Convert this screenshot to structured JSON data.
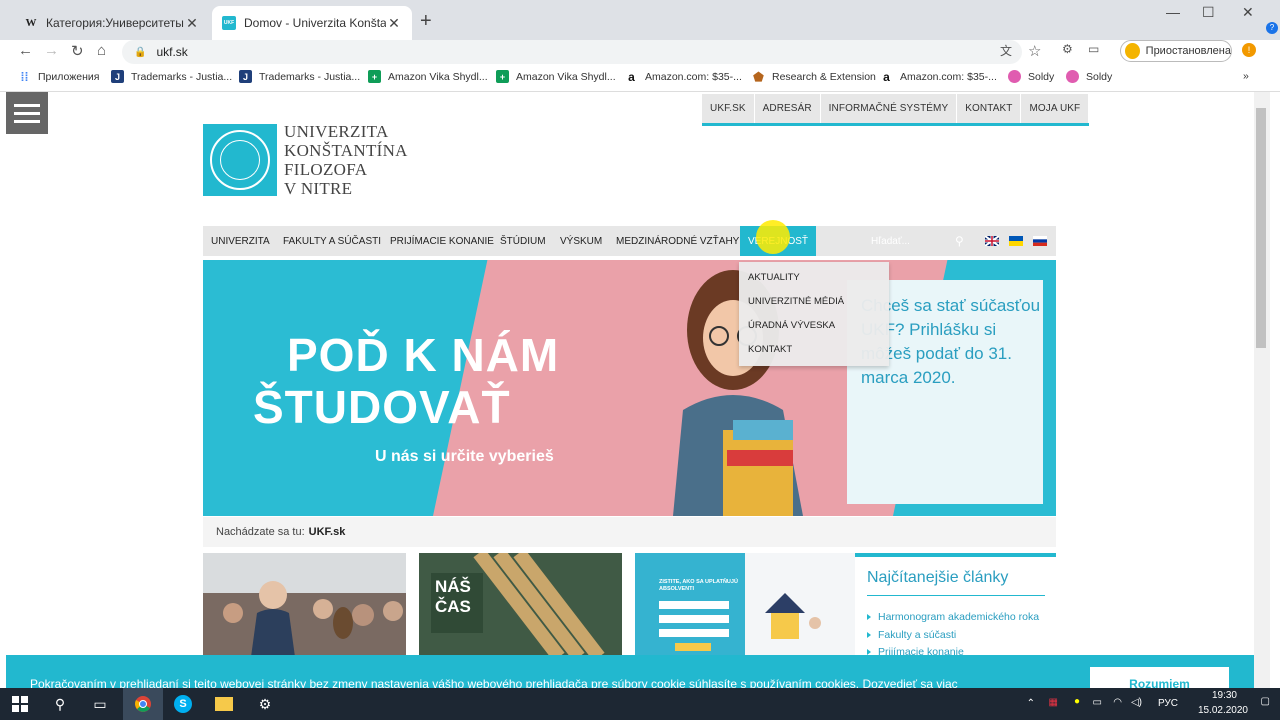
{
  "browser": {
    "tabs": [
      {
        "title": "Категория:Университеты Слова",
        "favicon": "W",
        "active": false
      },
      {
        "title": "Domov - Univerzita Konštantína F",
        "favicon": "UKF",
        "active": true
      }
    ],
    "new_tab_glyph": "+",
    "url": "ukf.sk",
    "profile_label": "Приостановлена",
    "bookmarks": [
      {
        "label": "Приложения",
        "icon": "apps-grid-icon",
        "color": "#4285f4"
      },
      {
        "label": "Trademarks - Justia...",
        "icon": "J",
        "color": "#1f3f7a"
      },
      {
        "label": "Trademarks - Justia...",
        "icon": "J",
        "color": "#1f3f7a"
      },
      {
        "label": "Amazon Vika Shydl...",
        "icon": "+",
        "color": "#0f9d58"
      },
      {
        "label": "Amazon Vika Shydl...",
        "icon": "+",
        "color": "#0f9d58"
      },
      {
        "label": "Amazon.com: $35-...",
        "icon": "a",
        "color": "#111111"
      },
      {
        "label": "Research & Extension",
        "icon": "⬟",
        "color": "#b5651d"
      },
      {
        "label": "Amazon.com: $35-...",
        "icon": "a",
        "color": "#111111"
      },
      {
        "label": "Soldy",
        "icon": "●",
        "color": "#e05cb0"
      },
      {
        "label": "Soldy",
        "icon": "●",
        "color": "#e05cb0"
      }
    ]
  },
  "site": {
    "top_links": [
      "UKF.SK",
      "ADRESÁR",
      "INFORMAČNÉ SYSTÉMY",
      "KONTAKT",
      "MOJA UKF"
    ],
    "university_name": [
      "UNIVERZITA",
      "KONŠTANTÍNA",
      "FILOZOFA",
      "V NITRE"
    ],
    "main_nav": [
      "UNIVERZITA",
      "FAKULTY A SÚČASTI",
      "PRIJÍMACIE KONANIE",
      "ŠTÚDIUM",
      "VÝSKUM",
      "MEDZINÁRODNÉ VZŤAHY",
      "VEREJNOSŤ"
    ],
    "search_placeholder": "Hľadať...",
    "dropdown": [
      "AKTUALITY",
      "UNIVERZITNÉ MÉDIÁ",
      "ÚRADNÁ VÝVESKA",
      "KONTAKT"
    ],
    "banner": {
      "headline_1": "POĎ K NÁM",
      "headline_2": "ŠTUDOVAŤ",
      "subline": "U nás si určite vyberieš",
      "info": "Chceš sa stať súčasťou UKF? Prihlášku si môžeš podať do 31. marca 2020."
    },
    "breadcrumb_prefix": "Nachádzate sa tu:",
    "breadcrumb_current": "UKF.sk",
    "card_magazine": "NÁŠ ČAS",
    "card_survey": "ZISTITE, AKO SA UPLATŇUJÚ ABSOLVENTI",
    "sidebar_title": "Najčítanejšie články",
    "sidebar_links": [
      "Harmonogram akademického roka",
      "Fakulty a súčasti",
      "Prijímacie konanie"
    ],
    "cookie_text": "Pokračovaním v prehliadaní si tejto webovej stránky bez zmeny nastavenia vášho webového prehliadača pre súbory cookie súhlasíte s používaním cookies. Dozvedieť sa viac",
    "cookie_button": "Rozumiem"
  },
  "taskbar": {
    "time": "19:30",
    "date": "15.02.2020",
    "lang": "РУС"
  },
  "colors": {
    "brand": "#22b8cf",
    "banner_pink": "#eaa1a9",
    "highlight": "#ffeb00"
  }
}
